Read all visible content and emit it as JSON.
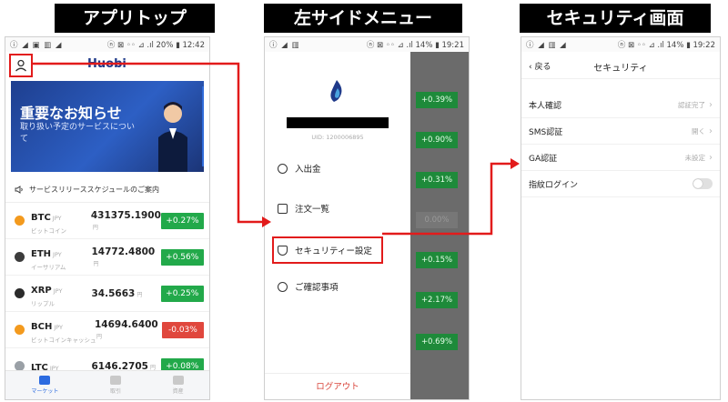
{
  "titles": {
    "panel1": "アプリトップ",
    "panel2": "左サイドメニュー",
    "panel3": "セキュリティ画面"
  },
  "status": {
    "p1_left": "ⓘ ◢ ▣ ▥ ◢",
    "p1_right": "ⓝ ⊠ ◦◦ ⊿ .ıl 20% ▮ 12:42",
    "p2_left": "ⓘ ◢ ▥",
    "p2_right": "ⓝ ⊠ ◦◦ ⊿ .ıl 14% ▮ 19:21",
    "p3_left": "ⓘ ◢ ▥ ◢",
    "p3_right": "ⓝ ⊠ ◦◦ ⊿ .ıl 14% ▮ 19:22"
  },
  "app_top": {
    "logo": "Huobi",
    "banner_title": "重要なお知らせ",
    "banner_sub": "取り扱い予定のサービスについて",
    "notice": "サービスリリーススケジュールのご案内",
    "coins": [
      {
        "sym": "BTC",
        "jpy": "JPY",
        "jp": "ビットコイン",
        "price": "431375.1900",
        "unit": "円",
        "change": "+0.27%",
        "color": "#f39a1e",
        "dir": "up"
      },
      {
        "sym": "ETH",
        "jpy": "JPY",
        "jp": "イーサリアム",
        "price": "14772.4800",
        "unit": "円",
        "change": "+0.56%",
        "color": "#3c3c3c",
        "dir": "up"
      },
      {
        "sym": "XRP",
        "jpy": "JPY",
        "jp": "リップル",
        "price": "34.5663",
        "unit": "円",
        "change": "+0.25%",
        "color": "#2b2b2b",
        "dir": "up"
      },
      {
        "sym": "BCH",
        "jpy": "JPY",
        "jp": "ビットコインキャッシュ",
        "price": "14694.6400",
        "unit": "円",
        "change": "-0.03%",
        "color": "#f39a1e",
        "dir": "down"
      },
      {
        "sym": "LTC",
        "jpy": "JPY",
        "jp": "",
        "price": "6146.2705",
        "unit": "円",
        "change": "+0.08%",
        "color": "#9aa0a6",
        "dir": "up"
      }
    ],
    "nav": [
      "マーケット",
      "取引",
      "資産"
    ]
  },
  "side_menu": {
    "uid": "UID: 1200006895",
    "items": [
      "入出金",
      "注文一覧",
      "セキュリティー設定",
      "ご確認事項"
    ],
    "logout": "ログアウト",
    "bg_changes": [
      "+0.39%",
      "+0.90%",
      "+0.31%",
      "0.00%",
      "+0.15%",
      "+2.17%",
      "+0.69%"
    ]
  },
  "security": {
    "back": "戻る",
    "title": "セキュリティ",
    "rows": [
      {
        "label": "本人確認",
        "status": "認証完了"
      },
      {
        "label": "SMS認証",
        "status": "開く"
      },
      {
        "label": "GA認証",
        "status": "未設定"
      },
      {
        "label": "指紋ログイン",
        "status": ""
      }
    ]
  },
  "colors": {
    "up": "#22a94a",
    "down": "#e0473d",
    "highlight": "#e21b1b",
    "accent": "#2c6be0"
  }
}
